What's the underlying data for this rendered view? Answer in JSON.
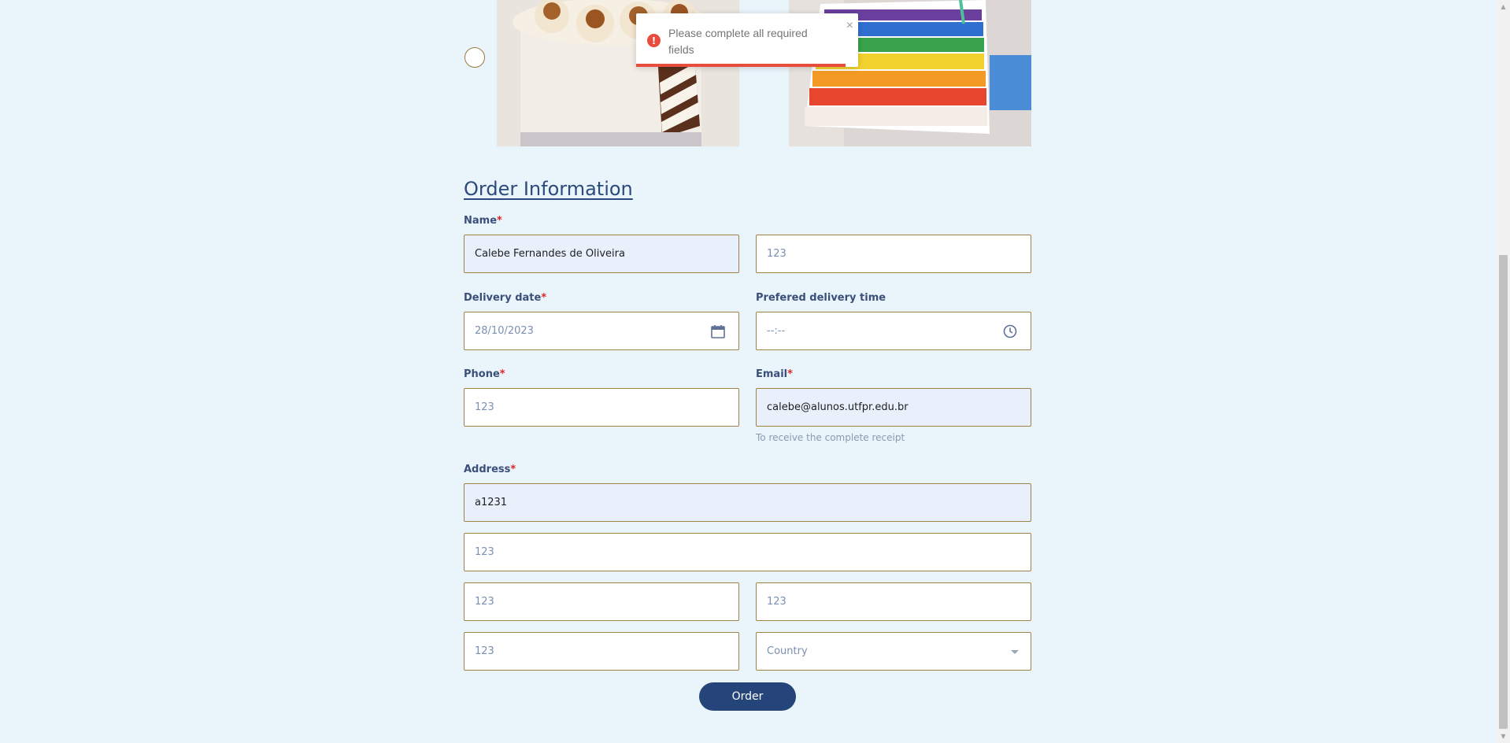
{
  "toast": {
    "message": "Please complete all required fields",
    "close_symbol": "×",
    "icon": "error-icon",
    "color": "#e74c3c"
  },
  "section": {
    "title": "Order Information"
  },
  "form": {
    "name_label": "Name",
    "required_mark": "*",
    "name_value": "Calebe Fernandes de Oliveira",
    "name2_placeholder": "123",
    "delivery_date_label": "Delivery date",
    "delivery_date_value": "28/10/2023",
    "delivery_time_label": "Prefered delivery time",
    "delivery_time_placeholder": "--:--",
    "phone_label": "Phone",
    "phone_placeholder": "123",
    "email_label": "Email",
    "email_value": "calebe@alunos.utfpr.edu.br",
    "email_hint": "To receive the complete receipt",
    "address_label": "Address",
    "address_value": "a1231",
    "address2_placeholder": "123",
    "address3_placeholder": "123",
    "address4_placeholder": "123",
    "address5_placeholder": "123",
    "country_placeholder": "Country",
    "order_button": "Order"
  },
  "colors": {
    "background": "#eaf4fb",
    "accent": "#25457a",
    "field_border": "#a0814a",
    "required": "#e02424"
  }
}
